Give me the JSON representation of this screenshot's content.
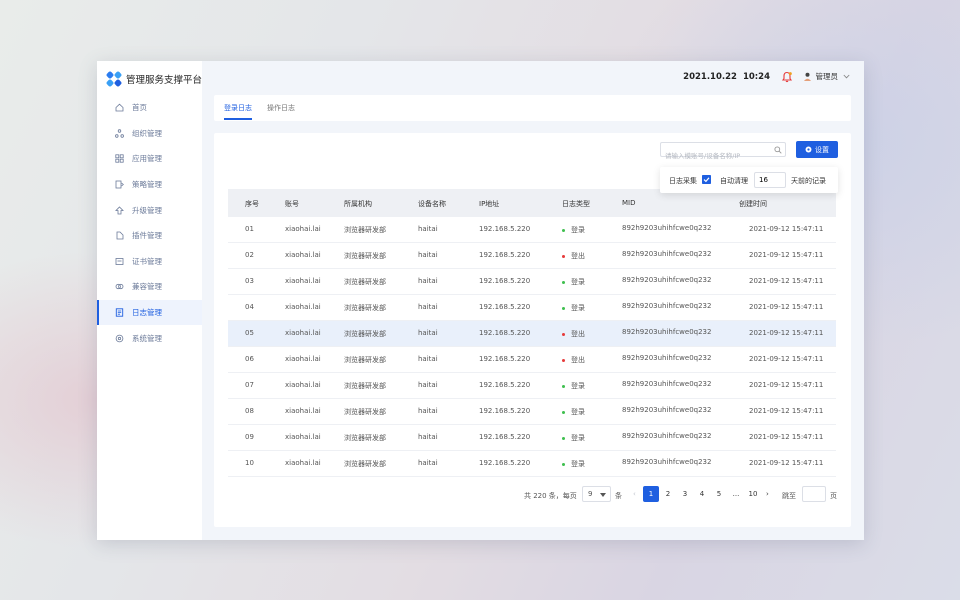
{
  "brand": {
    "title": "管理服务支撑平台"
  },
  "colors": {
    "accent": "#1f5fe0",
    "login": "#3fbf4f",
    "logout": "#e63a3a",
    "alert": "#f0a020"
  },
  "nav": [
    {
      "label": "首页",
      "icon": "home-icon"
    },
    {
      "label": "组织管理",
      "icon": "org-icon"
    },
    {
      "label": "应用管理",
      "icon": "apps-icon"
    },
    {
      "label": "策略管理",
      "icon": "policy-icon"
    },
    {
      "label": "升级管理",
      "icon": "upgrade-icon"
    },
    {
      "label": "插件管理",
      "icon": "plugin-icon"
    },
    {
      "label": "证书管理",
      "icon": "certificate-icon"
    },
    {
      "label": "兼容管理",
      "icon": "compat-icon"
    },
    {
      "label": "日志管理",
      "icon": "log-icon",
      "active": true
    },
    {
      "label": "系统管理",
      "icon": "system-icon"
    }
  ],
  "header": {
    "date": "2021.10.22",
    "time": "10:24",
    "user": "管理员"
  },
  "tabs": [
    {
      "label": "登录日志",
      "active": true
    },
    {
      "label": "操作日志"
    }
  ],
  "search": {
    "placeholder": "请输入模账号/设备名称/IP"
  },
  "settings_button": "设置",
  "settings_popover": {
    "collect_label": "日志采集",
    "collect_checked": true,
    "clean_label": "自动清理",
    "days_value": "16",
    "days_suffix": "天前的记录"
  },
  "table": {
    "columns": [
      "序号",
      "账号",
      "所属机构",
      "设备名称",
      "IP地址",
      "日志类型",
      "MID",
      "创建时间"
    ],
    "rows": [
      {
        "no": "01",
        "account": "xiaohai.lai",
        "org": "浏览器研发部",
        "device": "haitai",
        "ip": "192.168.5.220",
        "type": "登录",
        "kind": "login",
        "mid": "892h9203uhihfcwe0q232",
        "time": "2021-09-12 15:47:11"
      },
      {
        "no": "02",
        "account": "xiaohai.lai",
        "org": "浏览器研发部",
        "device": "haitai",
        "ip": "192.168.5.220",
        "type": "登出",
        "kind": "logout",
        "mid": "892h9203uhihfcwe0q232",
        "time": "2021-09-12 15:47:11"
      },
      {
        "no": "03",
        "account": "xiaohai.lai",
        "org": "浏览器研发部",
        "device": "haitai",
        "ip": "192.168.5.220",
        "type": "登录",
        "kind": "login",
        "mid": "892h9203uhihfcwe0q232",
        "time": "2021-09-12 15:47:11"
      },
      {
        "no": "04",
        "account": "xiaohai.lai",
        "org": "浏览器研发部",
        "device": "haitai",
        "ip": "192.168.5.220",
        "type": "登录",
        "kind": "login",
        "mid": "892h9203uhihfcwe0q232",
        "time": "2021-09-12 15:47:11"
      },
      {
        "no": "05",
        "account": "xiaohai.lai",
        "org": "浏览器研发部",
        "device": "haitai",
        "ip": "192.168.5.220",
        "type": "登出",
        "kind": "logout",
        "mid": "892h9203uhihfcwe0q232",
        "time": "2021-09-12 15:47:11",
        "highlight": true
      },
      {
        "no": "06",
        "account": "xiaohai.lai",
        "org": "浏览器研发部",
        "device": "haitai",
        "ip": "192.168.5.220",
        "type": "登出",
        "kind": "logout",
        "mid": "892h9203uhihfcwe0q232",
        "time": "2021-09-12 15:47:11"
      },
      {
        "no": "07",
        "account": "xiaohai.lai",
        "org": "浏览器研发部",
        "device": "haitai",
        "ip": "192.168.5.220",
        "type": "登录",
        "kind": "login",
        "mid": "892h9203uhihfcwe0q232",
        "time": "2021-09-12 15:47:11"
      },
      {
        "no": "08",
        "account": "xiaohai.lai",
        "org": "浏览器研发部",
        "device": "haitai",
        "ip": "192.168.5.220",
        "type": "登录",
        "kind": "login",
        "mid": "892h9203uhihfcwe0q232",
        "time": "2021-09-12 15:47:11"
      },
      {
        "no": "09",
        "account": "xiaohai.lai",
        "org": "浏览器研发部",
        "device": "haitai",
        "ip": "192.168.5.220",
        "type": "登录",
        "kind": "login",
        "mid": "892h9203uhihfcwe0q232",
        "time": "2021-09-12 15:47:11"
      },
      {
        "no": "10",
        "account": "xiaohai.lai",
        "org": "浏览器研发部",
        "device": "haitai",
        "ip": "192.168.5.220",
        "type": "登录",
        "kind": "login",
        "mid": "892h9203uhihfcwe0q232",
        "time": "2021-09-12 15:47:11"
      }
    ]
  },
  "pagination": {
    "total_text": "共 220 条，每页",
    "page_size": "9",
    "page_size_unit": "条",
    "pages": [
      "1",
      "2",
      "3",
      "4",
      "5",
      "...",
      "10"
    ],
    "current": "1",
    "jump_label": "跳至",
    "jump_unit": "页"
  }
}
